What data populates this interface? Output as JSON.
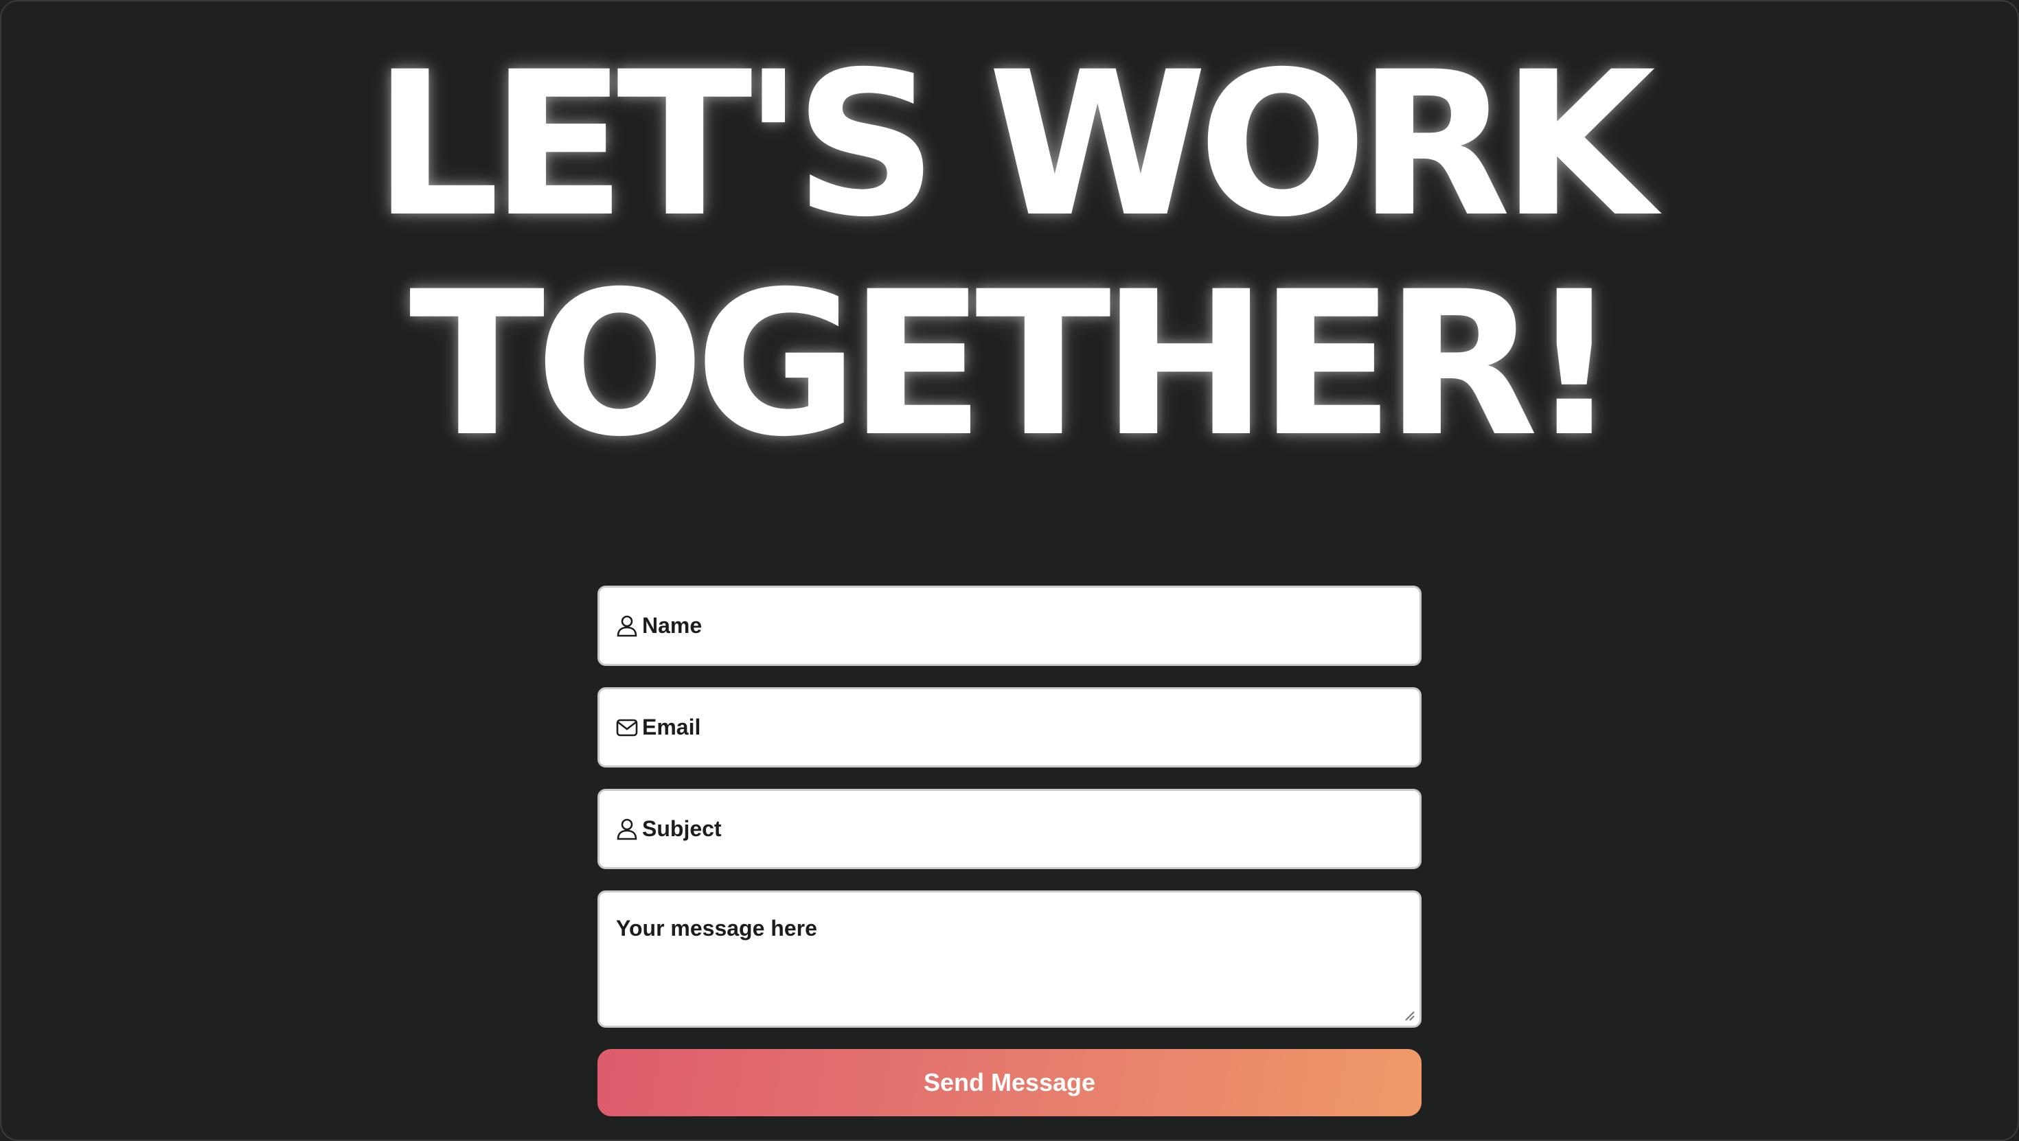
{
  "hero": {
    "line1": "LET'S WORK",
    "line2": "TOGETHER!"
  },
  "form": {
    "name_placeholder": "Name",
    "email_placeholder": "Email",
    "subject_placeholder": "Subject",
    "message_placeholder": "Your message here",
    "submit_label": "Send Message"
  },
  "icons": {
    "name": "user-icon",
    "email": "mail-icon",
    "subject": "user-icon"
  },
  "colors": {
    "background": "#1f2020",
    "button_gradient_start": "#dd5c6d",
    "button_gradient_end": "#f09a68"
  }
}
